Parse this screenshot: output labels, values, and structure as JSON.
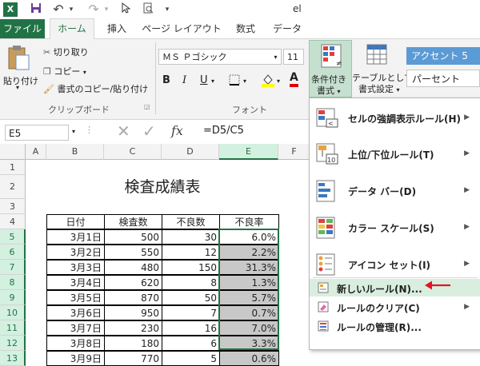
{
  "quick_access": {
    "filename_fragment": "el"
  },
  "tabs": [
    {
      "label": "ファイル",
      "active": false
    },
    {
      "label": "ホーム",
      "active": true
    },
    {
      "label": "挿入",
      "active": false
    },
    {
      "label": "ページ レイアウト",
      "active": false
    },
    {
      "label": "数式",
      "active": false
    },
    {
      "label": "データ",
      "active": false
    }
  ],
  "ribbon": {
    "clipboard": {
      "paste_label": "貼り付け",
      "cut_label": "切り取り",
      "copy_label": "コピー",
      "format_painter_label": "書式のコピー/貼り付け",
      "group_label": "クリップボード"
    },
    "font": {
      "font_name": "ＭＳ Ｐゴシック",
      "font_size": "11",
      "bold": "B",
      "italic": "I",
      "underline": "U",
      "group_label": "フォント"
    },
    "styles": {
      "conditional_formatting_line1": "条件付き",
      "conditional_formatting_line2": "書式",
      "format_as_table_line1": "テーブルとして",
      "format_as_table_line2": "書式設定",
      "accent_style": "アクセント 5",
      "percent_style": "パーセント"
    }
  },
  "formula_bar": {
    "name_box": "E5",
    "fx": "fx",
    "formula": "=D5/C5"
  },
  "columns": [
    "A",
    "B",
    "C",
    "D",
    "E",
    "F"
  ],
  "rows": [
    "1",
    "2",
    "3",
    "4",
    "5",
    "6",
    "7",
    "8",
    "9",
    "10",
    "11",
    "12",
    "13"
  ],
  "sheet": {
    "title": "検査成績表",
    "headers": [
      "日付",
      "検査数",
      "不良数",
      "不良率"
    ],
    "data": [
      [
        "3月1日",
        "500",
        "30",
        "6.0%"
      ],
      [
        "3月2日",
        "550",
        "12",
        "2.2%"
      ],
      [
        "3月3日",
        "480",
        "150",
        "31.3%"
      ],
      [
        "3月4日",
        "620",
        "8",
        "1.3%"
      ],
      [
        "3月5日",
        "870",
        "50",
        "5.7%"
      ],
      [
        "3月6日",
        "950",
        "7",
        "0.7%"
      ],
      [
        "3月7日",
        "230",
        "16",
        "7.0%"
      ],
      [
        "3月8日",
        "180",
        "6",
        "3.3%"
      ],
      [
        "3月9日",
        "770",
        "5",
        "0.6%"
      ]
    ]
  },
  "cf_menu": {
    "items": [
      {
        "label": "セルの強調表示ルール(H)",
        "has_submenu": true
      },
      {
        "label": "上位/下位ルール(T)",
        "has_submenu": true
      },
      {
        "label": "データ バー(D)",
        "has_submenu": true
      },
      {
        "label": "カラー スケール(S)",
        "has_submenu": true
      },
      {
        "label": "アイコン セット(I)",
        "has_submenu": true
      }
    ],
    "commands": [
      {
        "label": "新しいルール(N)..."
      },
      {
        "label": "ルールのクリア(C)"
      },
      {
        "label": "ルールの管理(R)..."
      }
    ],
    "highlight_color": "#d9eedf",
    "pointer_arrow_color": "#e81123"
  },
  "colors": {
    "excel_green": "#217346",
    "accent5": "#5b9bd5"
  }
}
